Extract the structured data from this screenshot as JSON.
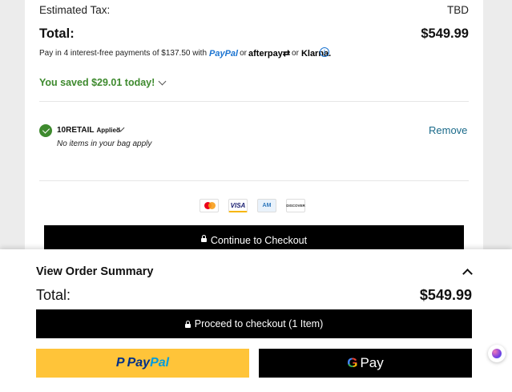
{
  "summary": {
    "estimated_tax_label": "Estimated Tax:",
    "estimated_tax_value": "TBD",
    "total_label": "Total:",
    "total_value": "$549.99",
    "installments_text": "Pay in 4 interest-free payments of $137.50 with",
    "installments_paypal": "PayPal",
    "installments_or1": "or",
    "installments_afterpay": "afterpay⇄",
    "installments_or2": "or",
    "installments_klarna": "Klarna.",
    "info_icon_glyph": "i",
    "saved_text": "You saved $29.01 today!"
  },
  "promo": {
    "code": "10RETAIL",
    "status": "Applied",
    "note": "No items in your bag apply",
    "remove_label": "Remove"
  },
  "payment_icons": [
    {
      "name": "mastercard-icon",
      "label": ""
    },
    {
      "name": "visa-icon",
      "label": "VISA"
    },
    {
      "name": "amex-icon",
      "label": "AM"
    },
    {
      "name": "discover-icon",
      "label": "DISCOVER"
    }
  ],
  "checkout": {
    "continue_label": "Continue to Checkout"
  },
  "sheet": {
    "title": "View Order Summary",
    "total_label": "Total:",
    "total_value": "$549.99",
    "proceed_label": "Proceed to checkout (1 Item)",
    "paypal_p": "P",
    "paypal_pay": "Pay",
    "paypal_pal": "Pal",
    "gpay_g": "G",
    "gpay_pay": "Pay"
  },
  "colors": {
    "saved_green": "#3e8a2e",
    "link_blue": "#1a6a8a",
    "paypal_yellow": "#ffc439"
  }
}
